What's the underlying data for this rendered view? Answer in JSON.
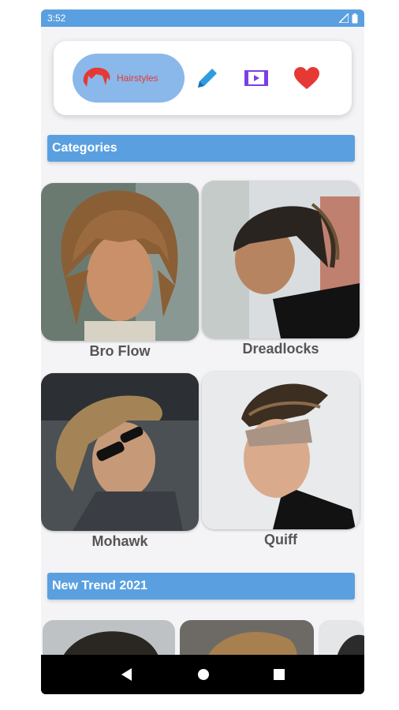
{
  "status_bar": {
    "time": "3:52"
  },
  "nav": {
    "hairstyles_label": "Hairstyles",
    "items": [
      "hairstyles",
      "edit",
      "video",
      "favorites"
    ]
  },
  "sections": {
    "categories": "Categories",
    "new_trend": "New Trend 2021"
  },
  "categories": [
    {
      "label": "Bro Flow"
    },
    {
      "label": "Dreadlocks"
    },
    {
      "label": "Mohawk"
    },
    {
      "label": "Quiff"
    }
  ],
  "colors": {
    "accent": "#5aa0e0",
    "pill": "#8ab8ea",
    "heart": "#e53935",
    "edit": "#2f9ce0",
    "video": "#7b3fe4"
  }
}
